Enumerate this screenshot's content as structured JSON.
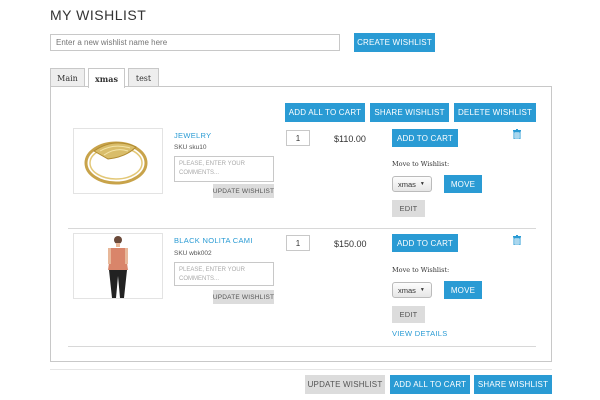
{
  "page": {
    "title": "MY WISHLIST",
    "new_wishlist_placeholder": "Enter a new wishlist name here",
    "create_wishlist": "CREATE WISHLIST"
  },
  "tabs": [
    {
      "label": "Main",
      "active": false
    },
    {
      "label": "xmas",
      "active": true
    },
    {
      "label": "test",
      "active": false
    }
  ],
  "panel_actions": {
    "add_all_to_cart": "ADD ALL TO CART",
    "share_wishlist": "SHARE WISHLIST",
    "delete_wishlist": "DELETE WISHLIST"
  },
  "items": [
    {
      "name": "JEWELRY",
      "sku": "SKU sku10",
      "comment_placeholder": "PLEASE, ENTER YOUR COMMENTS...",
      "update_label": "UPDATE WISHLIST",
      "qty": "1",
      "price": "$110.00",
      "add_to_cart": "ADD TO CART",
      "move_to_label": "Move to Wishlist:",
      "move_select": "xmas",
      "move_button": "MOVE",
      "edit_label": "EDIT",
      "trash_icon": "trash-icon"
    },
    {
      "name": "BLACK NOLITA CAMI",
      "sku": "SKU wbk002",
      "comment_placeholder": "PLEASE, ENTER YOUR COMMENTS...",
      "update_label": "UPDATE WISHLIST",
      "qty": "1",
      "price": "$150.00",
      "add_to_cart": "ADD TO CART",
      "move_to_label": "Move to Wishlist:",
      "move_select": "xmas",
      "move_button": "MOVE",
      "edit_label": "EDIT",
      "view_details": "VIEW DETAILS",
      "trash_icon": "trash-icon"
    }
  ],
  "footer": {
    "update_wishlist": "UPDATE WISHLIST",
    "add_all_to_cart": "ADD ALL TO CART",
    "share_wishlist": "SHARE WISHLIST"
  },
  "colors": {
    "accent": "#2a9bd4",
    "gray_button": "#dcdcdc"
  }
}
